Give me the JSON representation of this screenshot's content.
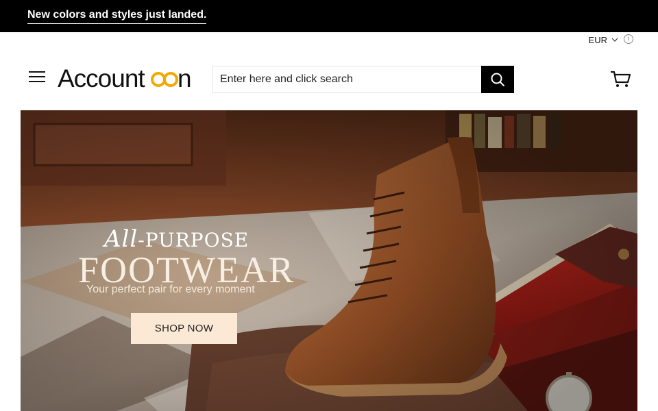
{
  "announcement": {
    "text": "New colors and styles just landed."
  },
  "currency": {
    "code": "EUR"
  },
  "header": {
    "logo_text_start": "Account",
    "logo_text_end": "n",
    "search_placeholder": "Enter here and click search"
  },
  "hero": {
    "kicker_script": "All",
    "kicker_rest": "-PURPOSE",
    "title": "FOOTWEAR",
    "subtitle": "Your perfect pair for every moment",
    "cta_label": "SHOP NOW"
  },
  "colors": {
    "announcement_bg": "#000000",
    "logo_accent": "#f2a900",
    "cta_bg": "#fbe9d6"
  },
  "icons": [
    "hamburger-icon",
    "search-icon",
    "cart-icon",
    "chevron-down-icon",
    "info-icon"
  ]
}
